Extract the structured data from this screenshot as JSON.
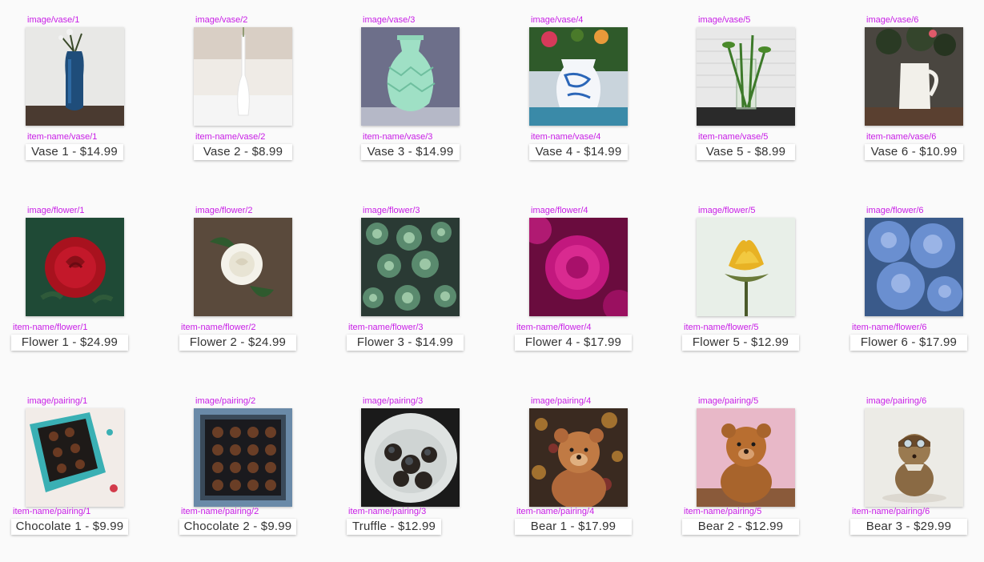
{
  "rows": [
    {
      "id": "vase",
      "items": [
        {
          "image_tag": "image/vase/1",
          "name_tag": "item-name/vase/1",
          "label": "Vase 1 - $14.99",
          "art": "vase-blue"
        },
        {
          "image_tag": "image/vase/2",
          "name_tag": "item-name/vase/2",
          "label": "Vase 2 - $8.99",
          "art": "vase-white-slim"
        },
        {
          "image_tag": "image/vase/3",
          "name_tag": "item-name/vase/3",
          "label": "Vase 3 - $14.99",
          "art": "vase-mint"
        },
        {
          "image_tag": "image/vase/4",
          "name_tag": "item-name/vase/4",
          "label": "Vase 4 - $14.99",
          "art": "vase-porcelain"
        },
        {
          "image_tag": "image/vase/5",
          "name_tag": "item-name/vase/5",
          "label": "Vase 5 - $8.99",
          "art": "vase-glass"
        },
        {
          "image_tag": "image/vase/6",
          "name_tag": "item-name/vase/6",
          "label": "Vase 6 - $10.99",
          "art": "vase-pitcher"
        }
      ]
    },
    {
      "id": "flower",
      "items": [
        {
          "image_tag": "image/flower/1",
          "name_tag": "item-name/flower/1",
          "label": "Flower 1 - $24.99",
          "art": "rose-red"
        },
        {
          "image_tag": "image/flower/2",
          "name_tag": "item-name/flower/2",
          "label": "Flower 2 - $24.99",
          "art": "rose-white"
        },
        {
          "image_tag": "image/flower/3",
          "name_tag": "item-name/flower/3",
          "label": "Flower 3 - $14.99",
          "art": "succulents"
        },
        {
          "image_tag": "image/flower/4",
          "name_tag": "item-name/flower/4",
          "label": "Flower 4 - $17.99",
          "art": "dahlia-pink"
        },
        {
          "image_tag": "image/flower/5",
          "name_tag": "item-name/flower/5",
          "label": "Flower 5 - $12.99",
          "art": "flower-yellow"
        },
        {
          "image_tag": "image/flower/6",
          "name_tag": "item-name/flower/6",
          "label": "Flower 6 - $17.99",
          "art": "hydrangea-blue"
        }
      ]
    },
    {
      "id": "pairing",
      "items": [
        {
          "image_tag": "image/pairing/1",
          "name_tag": "item-name/pairing/1",
          "label": "Chocolate 1 - $9.99",
          "art": "chocolate-box-teal"
        },
        {
          "image_tag": "image/pairing/2",
          "name_tag": "item-name/pairing/2",
          "label": "Chocolate 2 - $9.99",
          "art": "chocolate-box-dark"
        },
        {
          "image_tag": "image/pairing/3",
          "name_tag": "item-name/pairing/3",
          "label": "Truffle - $12.99",
          "art": "truffle-bowl"
        },
        {
          "image_tag": "image/pairing/4",
          "name_tag": "item-name/pairing/4",
          "label": "Bear 1 - $17.99",
          "art": "bear-bokeh"
        },
        {
          "image_tag": "image/pairing/5",
          "name_tag": "item-name/pairing/5",
          "label": "Bear 2 - $12.99",
          "art": "bear-brown"
        },
        {
          "image_tag": "image/pairing/6",
          "name_tag": "item-name/pairing/6",
          "label": "Bear 3 - $29.99",
          "art": "bear-aviator"
        }
      ]
    }
  ],
  "colors": {
    "tag": "#c81ee6",
    "label_text": "#333333",
    "label_bg": "#ffffff",
    "page_bg": "#fafafa"
  }
}
